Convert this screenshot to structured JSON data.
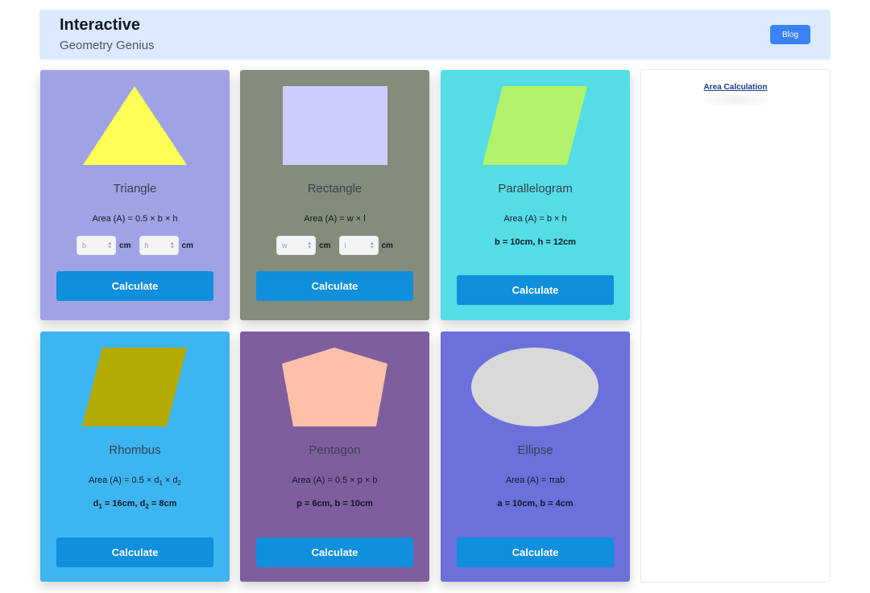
{
  "header": {
    "title": "Interactive",
    "subtitle": "Geometry Genius",
    "blog_label": "Blog"
  },
  "cards": [
    {
      "name": "Triangle",
      "formula": "Area (A) = 0.5 × b × h",
      "inputs": [
        {
          "placeholder": "b",
          "unit": "cm"
        },
        {
          "placeholder": "h",
          "unit": "cm"
        }
      ],
      "button": "Calculate",
      "bg": "#9fa3e4",
      "shape_color": "#ffff55"
    },
    {
      "name": "Rectangle",
      "formula": "Area (A) = w × l",
      "inputs": [
        {
          "placeholder": "w",
          "unit": "cm"
        },
        {
          "placeholder": "l",
          "unit": "cm"
        }
      ],
      "button": "Calculate",
      "bg": "#848c7b",
      "shape_color": "#ccccff"
    },
    {
      "name": "Parallelogram",
      "formula": "Area (A) = b × h",
      "params": "b = 10cm, h = 12cm",
      "button": "Calculate",
      "bg": "#55dde6",
      "shape_color": "#b2f26b"
    },
    {
      "name": "Rhombus",
      "formula_parts": {
        "prefix": "Area (A) = 0.5 × d",
        "s1": "1",
        "mid": " × d",
        "s2": "2"
      },
      "params_parts": {
        "a": "d",
        "s1": "1",
        "b": " = 16cm, d",
        "s2": "2",
        "c": " = 8cm"
      },
      "button": "Calculate",
      "bg": "#3db5f0",
      "shape_color": "#b3aa02"
    },
    {
      "name": "Pentagon",
      "formula": "Area (A) = 0.5 × p × b",
      "params": "p = 6cm, b = 10cm",
      "button": "Calculate",
      "bg": "#7f5e9e",
      "shape_color": "#ffc0aa"
    },
    {
      "name": "Ellipse",
      "formula": "Area (A) = πab",
      "params": "a = 10cm, b = 4cm",
      "button": "Calculate",
      "bg": "#6b70db",
      "shape_color": "#d9d9d9"
    }
  ],
  "sidebar": {
    "link": "Area Calculation"
  }
}
